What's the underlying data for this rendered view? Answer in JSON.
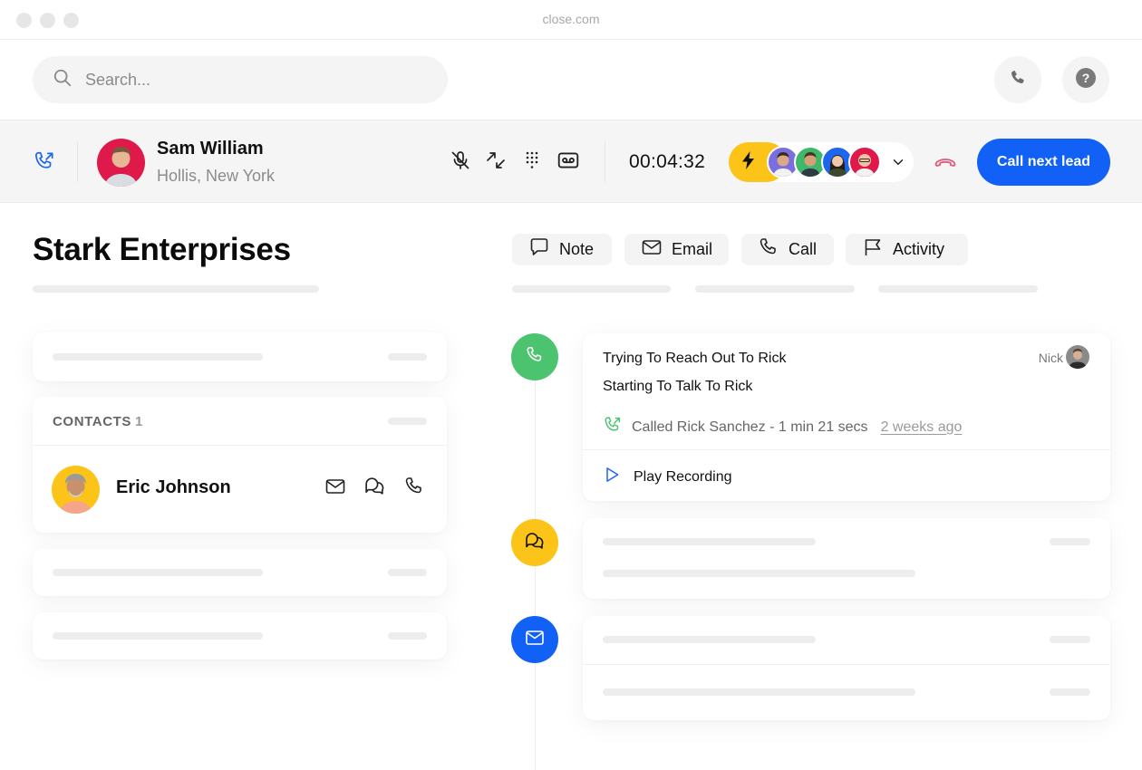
{
  "window": {
    "url": "close.com"
  },
  "topbar": {
    "search_placeholder": "Search...",
    "phone_button": "phone-icon",
    "help_button": "help-icon"
  },
  "callbar": {
    "direction_icon": "outgoing-call-icon",
    "caller": {
      "name": "Sam William",
      "location": "Hollis, New York"
    },
    "controls": [
      "mute-icon",
      "transfer-icon",
      "keypad-icon",
      "voicemail-icon"
    ],
    "timer": "00:04:32",
    "team": {
      "icon": "bolt-icon",
      "avatars": [
        {
          "color": "#7b6fe0"
        },
        {
          "color": "#40b86a"
        },
        {
          "color": "#1d66ee"
        },
        {
          "color": "#e0194b"
        }
      ]
    },
    "hangup_icon": "hangup-icon",
    "call_next_label": "Call next lead",
    "colors": {
      "accent": "#1261f7",
      "bolt": "#fcc419",
      "hangup": "#e05a7a"
    }
  },
  "lead": {
    "company": "Stark Enterprises",
    "contacts": {
      "title": "CONTACTS",
      "count": "1",
      "items": [
        {
          "name": "Eric Johnson",
          "actions": [
            "email-icon",
            "sms-icon",
            "phone-icon"
          ]
        }
      ]
    }
  },
  "activity": {
    "tabs": [
      {
        "label": "Note",
        "icon": "note-icon"
      },
      {
        "label": "Email",
        "icon": "email-icon"
      },
      {
        "label": "Call",
        "icon": "phone-icon"
      },
      {
        "label": "Activity",
        "icon": "flag-icon"
      }
    ],
    "items": [
      {
        "type": "call",
        "color": "#4cc36f",
        "title": "Trying To Reach Out To Rick",
        "subtitle": "Starting To Talk To Rick",
        "user": "Nick",
        "meta": "Called Rick Sanchez - 1 min 21 secs",
        "ago": "2 weeks ago",
        "play_label": "Play Recording"
      },
      {
        "type": "sms",
        "color": "#fcc419"
      },
      {
        "type": "email",
        "color": "#1261f7"
      }
    ]
  }
}
